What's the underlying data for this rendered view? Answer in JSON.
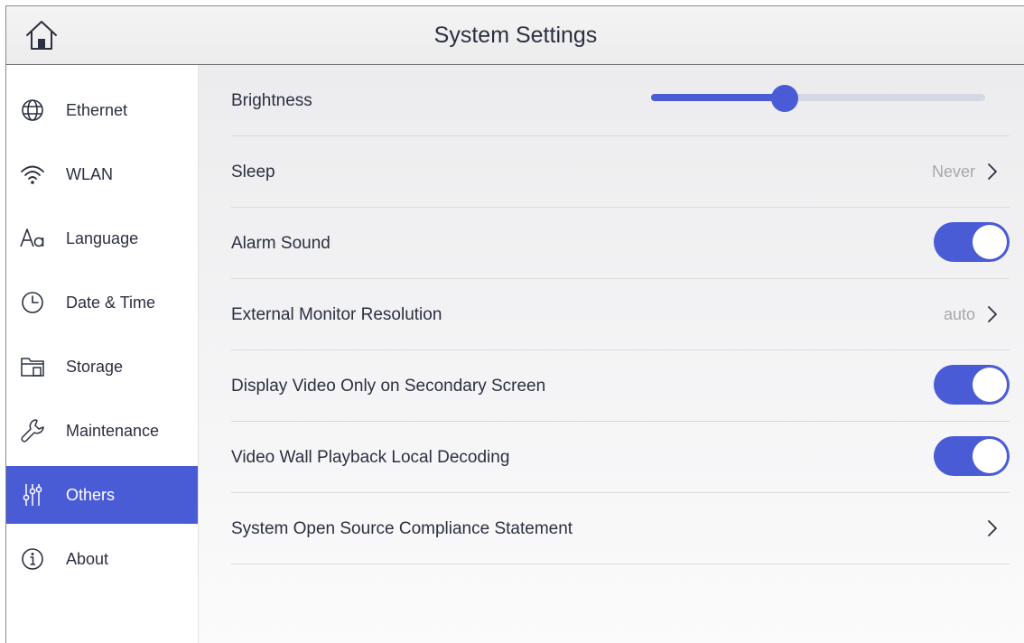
{
  "header": {
    "title": "System Settings",
    "home_icon": "home-icon"
  },
  "colors": {
    "accent": "#4a5bd6",
    "value_text": "#a6a8ad",
    "divider": "#d9dadd"
  },
  "sidebar": {
    "selected": "Others",
    "items": [
      {
        "label": "Ethernet",
        "icon": "globe-icon"
      },
      {
        "label": "WLAN",
        "icon": "wifi-icon"
      },
      {
        "label": "Language",
        "icon": "font-icon"
      },
      {
        "label": "Date & Time",
        "icon": "clock-icon"
      },
      {
        "label": "Storage",
        "icon": "folder-icon"
      },
      {
        "label": "Maintenance",
        "icon": "wrench-icon"
      },
      {
        "label": "Others",
        "icon": "sliders-icon"
      },
      {
        "label": "About",
        "icon": "info-icon"
      }
    ]
  },
  "settings": {
    "brightness": {
      "label": "Brightness",
      "level": 0.4
    },
    "sleep": {
      "label": "Sleep",
      "value": "Never"
    },
    "alarm_sound": {
      "label": "Alarm Sound",
      "enabled": true
    },
    "external_monitor": {
      "label": "External Monitor Resolution",
      "value": "auto"
    },
    "video_secondary": {
      "label": "Display Video Only on Secondary Screen",
      "enabled": true
    },
    "video_wall": {
      "label": "Video Wall Playback Local Decoding",
      "enabled": true
    },
    "open_source": {
      "label": "System Open Source Compliance Statement"
    }
  }
}
